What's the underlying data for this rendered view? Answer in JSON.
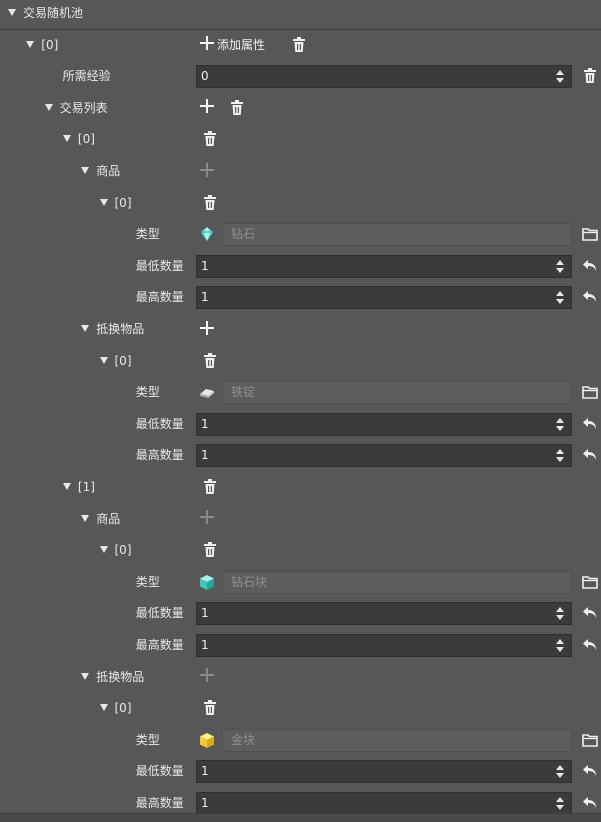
{
  "colors": {
    "background": "#575757",
    "field": "#3b3b3b",
    "select": "#5d5d5d",
    "placeholder": "#8e8e8e",
    "text": "#e6e6e6"
  },
  "rows": [
    {
      "type": "header",
      "label": "交易随机池",
      "indent": 0,
      "tri": true
    },
    {
      "type": "header",
      "label": "[0]",
      "indent": 1,
      "tri": true,
      "add_text": "添加属性",
      "trash": true
    },
    {
      "type": "number",
      "label": "所需经验",
      "indent": 2,
      "value": "0",
      "side": "trash"
    },
    {
      "type": "header",
      "label": "交易列表",
      "indent": 2,
      "tri": true,
      "add": true,
      "trash": true
    },
    {
      "type": "header",
      "label": "[0]",
      "indent": 3,
      "tri": true,
      "trash": true
    },
    {
      "type": "header",
      "label": "商品",
      "indent": 4,
      "tri": true,
      "add_disabled": true
    },
    {
      "type": "header",
      "label": "[0]",
      "indent": 5,
      "tri": true,
      "trash": true
    },
    {
      "type": "select",
      "label": "类型",
      "indent": 6,
      "item": "diamond-icon",
      "placeholder": "钻石"
    },
    {
      "type": "number",
      "label": "最低数量",
      "indent": 6,
      "value": "1",
      "side": "reset"
    },
    {
      "type": "number",
      "label": "最高数量",
      "indent": 6,
      "value": "1",
      "side": "reset"
    },
    {
      "type": "header",
      "label": "抵换物品",
      "indent": 4,
      "tri": true,
      "add": true
    },
    {
      "type": "header",
      "label": "[0]",
      "indent": 5,
      "tri": true,
      "trash": true
    },
    {
      "type": "select",
      "label": "类型",
      "indent": 6,
      "item": "iron-ingot-icon",
      "placeholder": "铁锭"
    },
    {
      "type": "number",
      "label": "最低数量",
      "indent": 6,
      "value": "1",
      "side": "reset"
    },
    {
      "type": "number",
      "label": "最高数量",
      "indent": 6,
      "value": "1",
      "side": "reset"
    },
    {
      "type": "header",
      "label": "[1]",
      "indent": 3,
      "tri": true,
      "trash": true
    },
    {
      "type": "header",
      "label": "商品",
      "indent": 4,
      "tri": true,
      "add_disabled": true
    },
    {
      "type": "header",
      "label": "[0]",
      "indent": 5,
      "tri": true,
      "trash": true
    },
    {
      "type": "select",
      "label": "类型",
      "indent": 6,
      "item": "diamond-block-icon",
      "placeholder": "钻石块"
    },
    {
      "type": "number",
      "label": "最低数量",
      "indent": 6,
      "value": "1",
      "side": "reset"
    },
    {
      "type": "number",
      "label": "最高数量",
      "indent": 6,
      "value": "1",
      "side": "reset"
    },
    {
      "type": "header",
      "label": "抵换物品",
      "indent": 4,
      "tri": true,
      "add_disabled": true
    },
    {
      "type": "header",
      "label": "[0]",
      "indent": 5,
      "tri": true,
      "trash": true
    },
    {
      "type": "select",
      "label": "类型",
      "indent": 6,
      "item": "gold-block-icon",
      "placeholder": "金块"
    },
    {
      "type": "number",
      "label": "最低数量",
      "indent": 6,
      "value": "1",
      "side": "reset"
    },
    {
      "type": "number",
      "label": "最高数量",
      "indent": 6,
      "value": "1",
      "side": "reset"
    }
  ]
}
